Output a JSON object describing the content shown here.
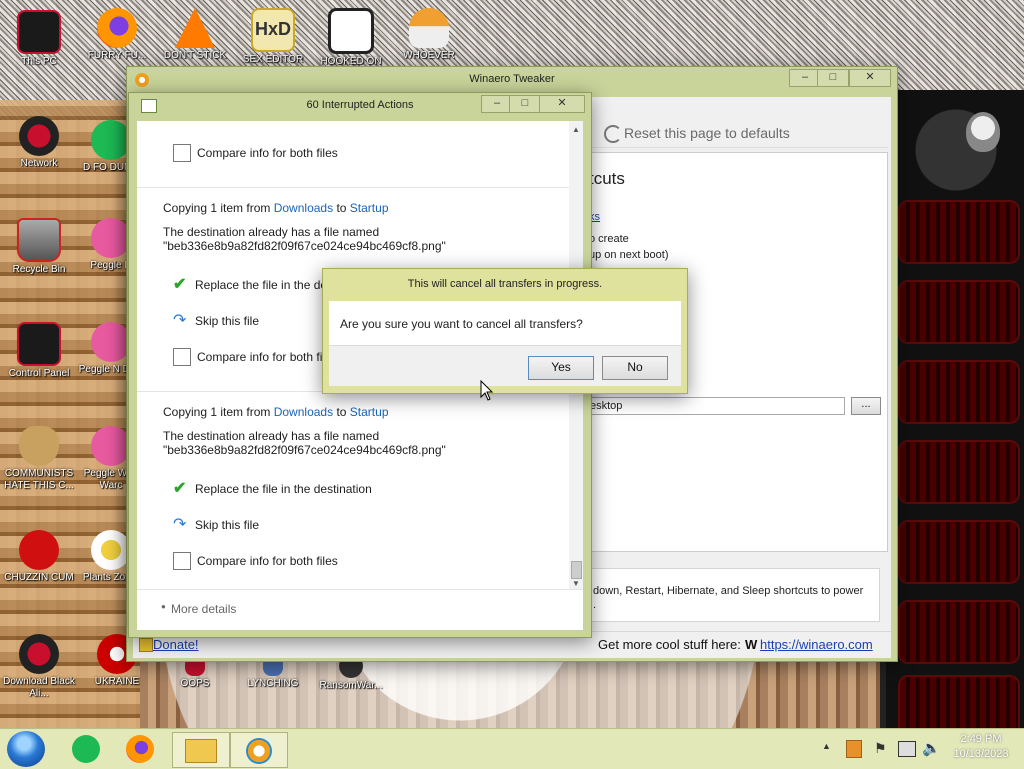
{
  "desktop_icons": [
    {
      "label": "This PC",
      "color": "#c8102e"
    },
    {
      "label": "FURRY FU...",
      "color": "#ff7b00"
    },
    {
      "label": "DON'T STICK",
      "color": "#ff6a00"
    },
    {
      "label": "SEX EDITOR",
      "color": "#c7a92c"
    },
    {
      "label": "HOOKED ON",
      "color": "#222222"
    },
    {
      "label": "WHOEVER",
      "color": "#f0a030"
    },
    {
      "label": "Network",
      "color": "#c8102e"
    },
    {
      "label": "D FO DUMB",
      "color": "#1db954"
    },
    {
      "label": "Recycle Bin",
      "color": "#cc2222"
    },
    {
      "label": "Peggle D",
      "color": "#e85aa0"
    },
    {
      "label": "Control Panel",
      "color": "#c8102e"
    },
    {
      "label": "Peggle N Delu",
      "color": "#e85aa0"
    },
    {
      "label": "COMMUNISTS HATE THIS C...",
      "color": "#c8a060"
    },
    {
      "label": "Peggle W of Warc",
      "color": "#e85aa0"
    },
    {
      "label": "CHUZZIN CUM",
      "color": "#d01010"
    },
    {
      "label": "Plants Zomb",
      "color": "#8bc34a"
    },
    {
      "label": "Download Black Ali...",
      "color": "#c8102e"
    },
    {
      "label": "UKRAINE",
      "color": "#cc0000"
    },
    {
      "label": "OOPS",
      "color": "#c8102e"
    },
    {
      "label": "LYNCHING",
      "color": "#4a6fb0"
    },
    {
      "label": "RansomWar...",
      "color": "#555555"
    }
  ],
  "tweaker": {
    "title": "Winaero Tweaker",
    "reset_label": "Reset this page to defaults",
    "heading_fragment": "tcuts",
    "link_fragment": "ks",
    "line1": "o create",
    "line2": "up on next boot)",
    "path_value": "esktop",
    "browse_label": "...",
    "description": "down, Restart, Hibernate, and Sleep shortcuts to power",
    "description_line2": ".",
    "donate_label": "Donate!",
    "footer_text": "Get more cool stuff here:",
    "footer_link": "https://winaero.com"
  },
  "interrupted": {
    "title": "60 Interrupted Actions",
    "top_compare_label": "Compare info for both files",
    "sections": [
      {
        "copying_prefix": "Copying 1 item from",
        "from": "Downloads",
        "to_word": "to",
        "to": "Startup",
        "destination_text": "The destination already has a file named",
        "filename": "\"beb336e8b9a82fd82f09f67ce024ce94bc469cf8.png\"",
        "replace_label": "Replace the file in the destination",
        "skip_label": "Skip this file",
        "compare_label": "Compare info for both files"
      },
      {
        "copying_prefix": "Copying 1 item from",
        "from": "Downloads",
        "to_word": "to",
        "to": "Startup",
        "destination_text": "The destination already has a file named",
        "filename": "\"beb336e8b9a82fd82f09f67ce024ce94bc469cf8.png\"",
        "replace_label": "Replace the file in the destination",
        "skip_label": "Skip this file",
        "compare_label": "Compare info for both files"
      }
    ],
    "more_details": "More details"
  },
  "confirm": {
    "title": "This will cancel all transfers in progress.",
    "question": "Are you sure you want to cancel all transfers?",
    "yes_label": "Yes",
    "no_label": "No"
  },
  "taskbar": {
    "time": "2:49 PM",
    "date": "10/13/2023"
  },
  "colors": {
    "window_frame": "#c8d49a",
    "link_blue": "#1a64b8",
    "check_green": "#2aa52a"
  }
}
